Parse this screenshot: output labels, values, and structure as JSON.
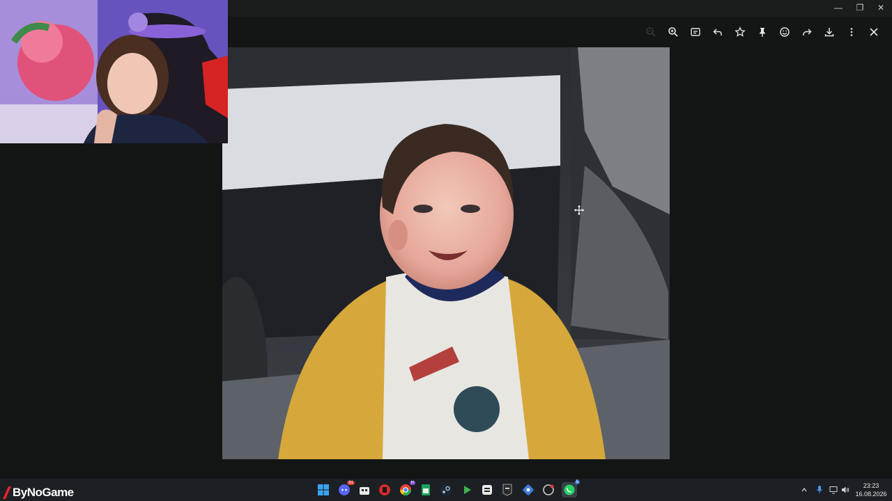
{
  "window": {
    "controls": {
      "minimize": "—",
      "restore": "❐",
      "close": "✕"
    }
  },
  "toolbar": {
    "icons": [
      "zoom-out-icon",
      "zoom-in-icon",
      "caption-icon",
      "reply-icon",
      "star-icon",
      "pin-icon",
      "emoji-icon",
      "forward-icon",
      "download-icon",
      "more-icon",
      "close-icon"
    ]
  },
  "overlay": {
    "brand": "ByNoGame"
  },
  "taskbar": {
    "badges": {
      "discord": "91",
      "notes": "H",
      "sheets": "5"
    },
    "clock": {
      "time": "23:23",
      "date": "16.08.2026"
    }
  },
  "colors": {
    "accent_whatsapp": "#25d366",
    "brand_red": "#e8232a",
    "sweater_yellow": "#d6a73a"
  }
}
